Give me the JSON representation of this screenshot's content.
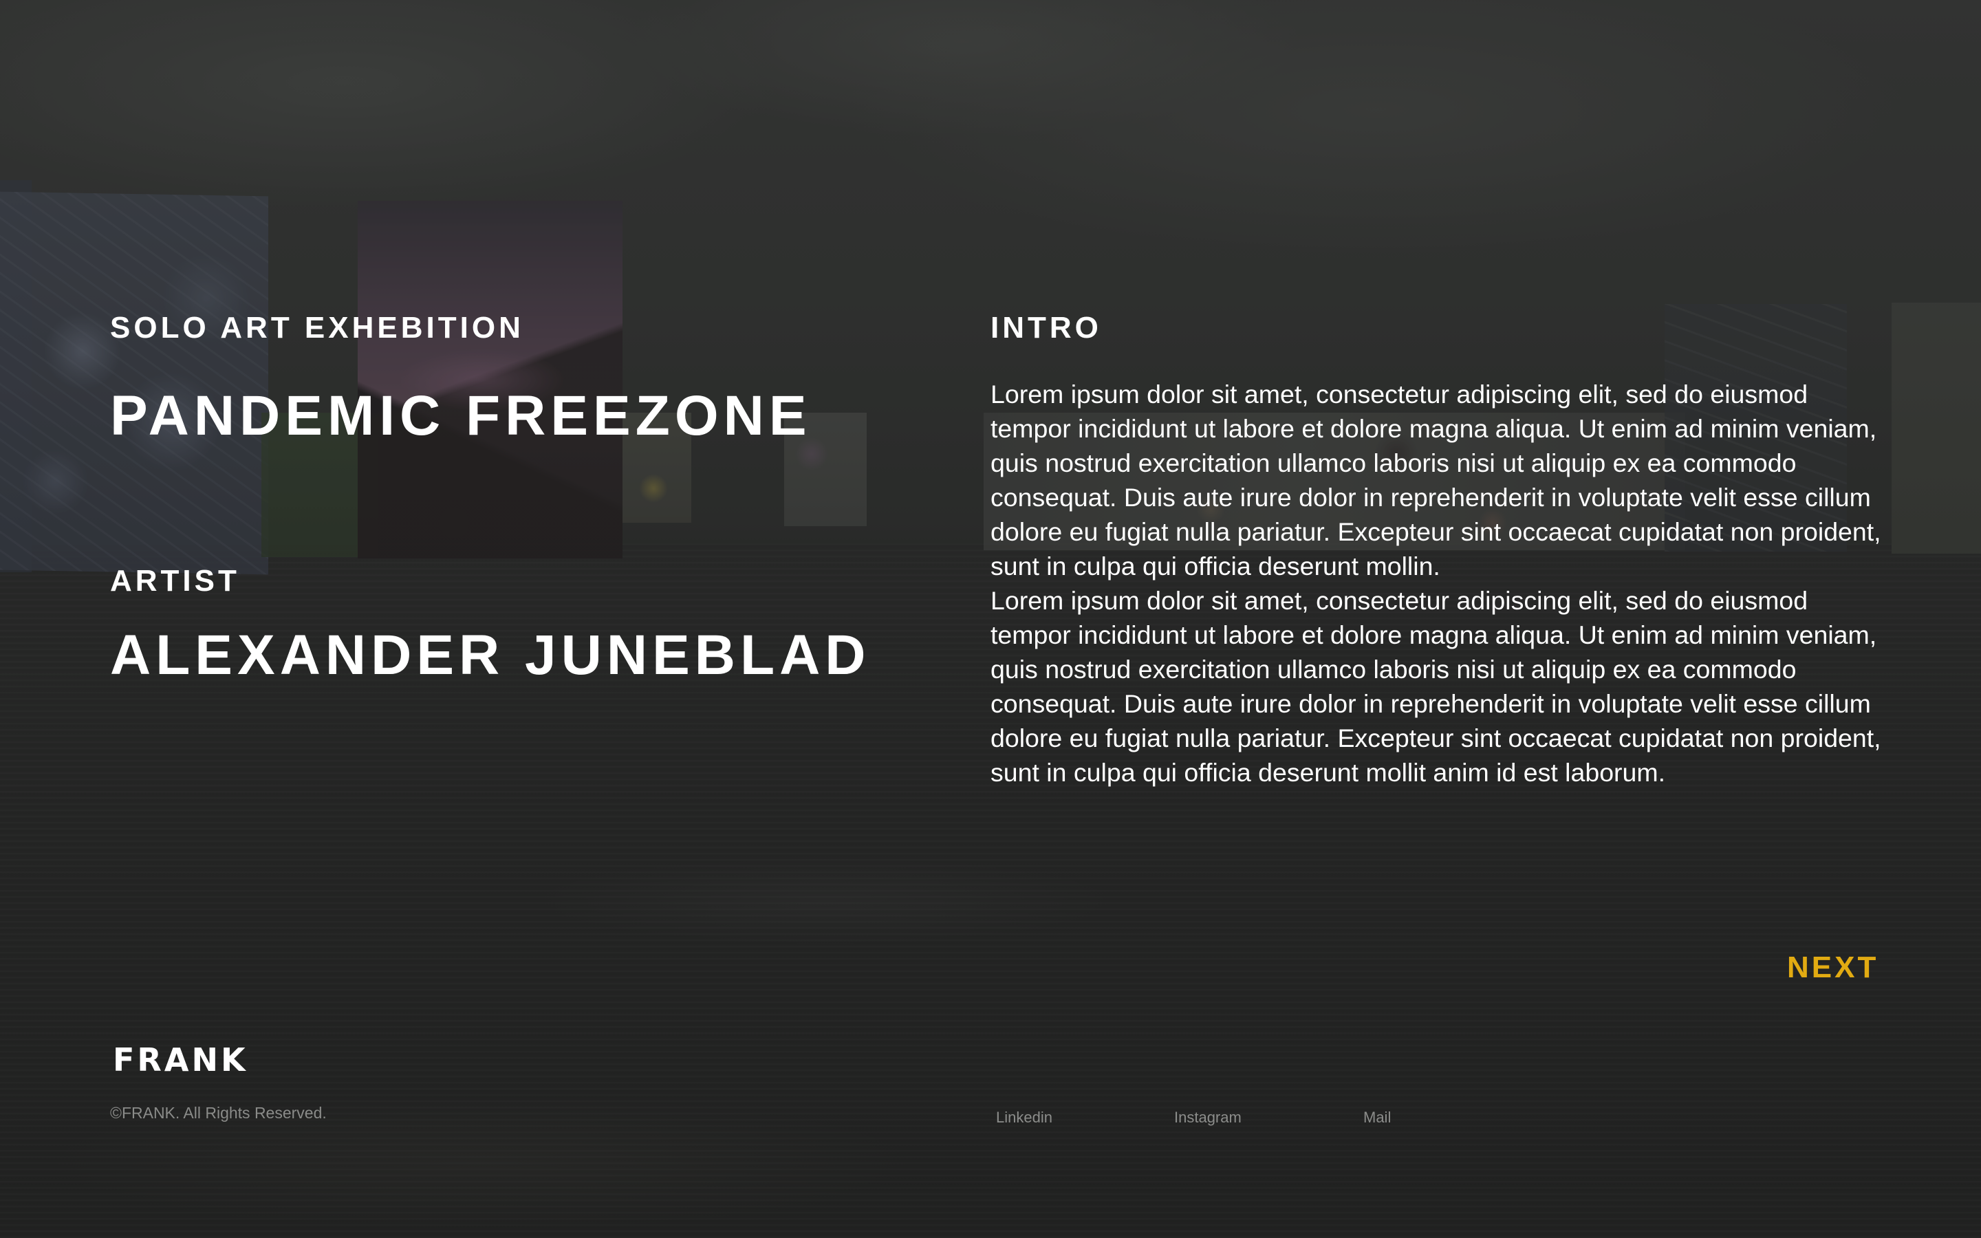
{
  "hero": {
    "eyebrow": "SOLO ART EXHEBITION",
    "title": "PANDEMIC FREEZONE",
    "artist_label": "ARTIST",
    "artist_name": "ALEXANDER JUNEBLAD"
  },
  "intro": {
    "heading": "INTRO",
    "paragraphs": [
      "Lorem ipsum dolor sit amet, consectetur adipiscing elit, sed do eiusmod tempor incididunt ut labore et dolore magna aliqua. Ut enim ad minim veniam, quis nostrud exercitation ullamco laboris nisi ut aliquip ex ea commodo consequat. Duis aute irure dolor in reprehenderit in voluptate velit esse cillum dolore eu fugiat nulla pariatur. Excepteur sint occaecat cupidatat non proident, sunt in culpa qui officia deserunt mollin.",
      "Lorem ipsum dolor sit amet, consectetur adipiscing elit, sed do eiusmod tempor incididunt ut labore et dolore magna aliqua. Ut enim ad minim veniam, quis nostrud exercitation ullamco laboris nisi ut aliquip ex ea commodo consequat. Duis aute irure dolor in reprehenderit in voluptate velit esse cillum dolore eu fugiat nulla pariatur. Excepteur sint occaecat cupidatat non proident, sunt in culpa qui officia deserunt mollit anim id est laborum."
    ]
  },
  "nav": {
    "next_label": "NEXT"
  },
  "footer": {
    "logo": "FRANK",
    "copyright": "©FRANK. All Rights Reserved.",
    "links": [
      "Linkedin",
      "Instagram",
      "Mail"
    ]
  },
  "colors": {
    "accent": "#e2ab12",
    "text": "#ffffff",
    "muted": "#8a8b89",
    "background": "#2c2d2c"
  }
}
